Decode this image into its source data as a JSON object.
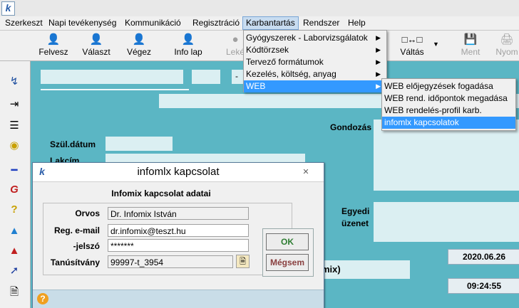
{
  "app": {
    "logo": "k"
  },
  "menubar": {
    "items": [
      "Szerkeszt",
      "Napi tevékenység",
      "Kommunikáció",
      "Regisztráció",
      "Karbantartás",
      "Rendszer",
      "Help"
    ],
    "active": "Karbantartás"
  },
  "toolbar": {
    "felvesz": "Felvesz",
    "valaszt": "Választ",
    "vegez": "Végez",
    "infolap": "Info lap",
    "lekerd": "Leké",
    "valtas": "Váltás",
    "ment": "Ment",
    "nyomtat": "Nyom"
  },
  "karbantartas_menu": {
    "items": [
      {
        "label": "Gyógyszerek - Laborvizsgálatok",
        "submenu": true
      },
      {
        "label": "Kódtörzsek",
        "submenu": true
      },
      {
        "label": "Tervező formátumok",
        "submenu": true
      },
      {
        "label": "Kezelés, költség, anyag",
        "submenu": true
      },
      {
        "label": "WEB",
        "submenu": true
      }
    ],
    "highlighted": "WEB"
  },
  "web_submenu": {
    "items": [
      "WEB előjegyzések fogadása",
      "WEB rend. időpontok megadása",
      "WEB rendelés-profil karb.",
      "infomlx kapcsolatok"
    ],
    "highlighted": "infomlx kapcsolatok"
  },
  "main": {
    "szul_datum_label": "Szül.dátum",
    "lakcim_label": "Lakcím",
    "gondozas_label": "Gondozás",
    "egyedi_label": "Egyedi",
    "uzenet_label": "üzenet",
    "dash": "-",
    "date": "2020.06.26",
    "time": "09:24:55",
    "partial_text": "mix)"
  },
  "dialog": {
    "title": "infomlx kapcsolat",
    "group_header": "Infomix kapcsolat adatai",
    "fields": {
      "orvos_label": "Orvos",
      "orvos_value": "Dr. Infomix István",
      "email_label": "Reg. e-mail",
      "email_value": "dr.infomix@teszt.hu",
      "jelszo_label": "-jelszó",
      "jelszo_value": "*******",
      "tanusitvany_label": "Tanúsítvány",
      "tanusitvany_value": "99997-t_3954"
    },
    "ok_label": "OK",
    "cancel_label": "Mégsem"
  },
  "colors": {
    "main_bg": "#5bb6c4",
    "highlight": "#3399ff",
    "ok_text": "#2e7d32",
    "cancel_text": "#8a4040"
  }
}
